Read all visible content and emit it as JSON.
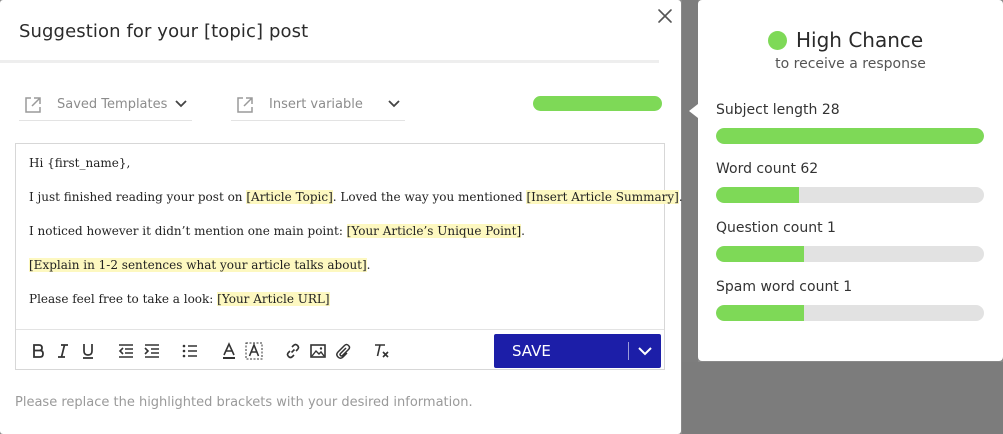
{
  "modal": {
    "title": "Suggestion for your [topic] post",
    "templates_label": "Saved Templates",
    "variable_label": "Insert variable",
    "top_progress": 1.0,
    "editor": {
      "lines": [
        {
          "parts": [
            {
              "text": "Hi {first_name},",
              "hl": false
            }
          ]
        },
        {
          "parts": [
            {
              "text": "I just finished reading your post on ",
              "hl": false
            },
            {
              "text": "[Article Topic]",
              "hl": true
            },
            {
              "text": ". Loved the way you mentioned ",
              "hl": false
            },
            {
              "text": "[Insert Article Summary]",
              "hl": true
            },
            {
              "text": ".",
              "hl": false
            }
          ]
        },
        {
          "parts": [
            {
              "text": "I noticed however it didn’t mention one main point: ",
              "hl": false
            },
            {
              "text": "[Your Article’s Unique Point]",
              "hl": true
            },
            {
              "text": ".",
              "hl": false
            }
          ]
        },
        {
          "parts": [
            {
              "text": "[Explain in 1-2 sentences what your article talks about]",
              "hl": true
            },
            {
              "text": ".",
              "hl": false
            }
          ]
        },
        {
          "parts": [
            {
              "text": "Please feel free to take a look: ",
              "hl": false
            },
            {
              "text": "[Your Article URL]",
              "hl": true
            }
          ]
        }
      ]
    },
    "save_label": "SAVE",
    "footer_note": "Please replace the highlighted brackets with your desired information."
  },
  "panel": {
    "chance_label": "High Chance",
    "chance_sub": "to receive a response",
    "metrics": [
      {
        "label": "Subject length 28",
        "fill": 1.0
      },
      {
        "label": "Word count 62",
        "fill": 0.31
      },
      {
        "label": "Question count 1",
        "fill": 0.33
      },
      {
        "label": "Spam word count 1",
        "fill": 0.33
      }
    ]
  },
  "colors": {
    "accent_green": "#7ed957",
    "save_blue": "#1c1ea8",
    "highlight": "#fdf8c0"
  },
  "icons": {
    "close": "close-icon",
    "templates": "external-link-icon",
    "variable": "external-link-icon",
    "chevron": "chevron-down-icon",
    "toolbar": [
      "bold-icon",
      "italic-icon",
      "underline-icon",
      "outdent-icon",
      "indent-icon",
      "bullet-list-icon",
      "text-color-icon",
      "highlight-color-icon",
      "link-icon",
      "image-icon",
      "attachment-icon",
      "clear-format-icon"
    ]
  }
}
